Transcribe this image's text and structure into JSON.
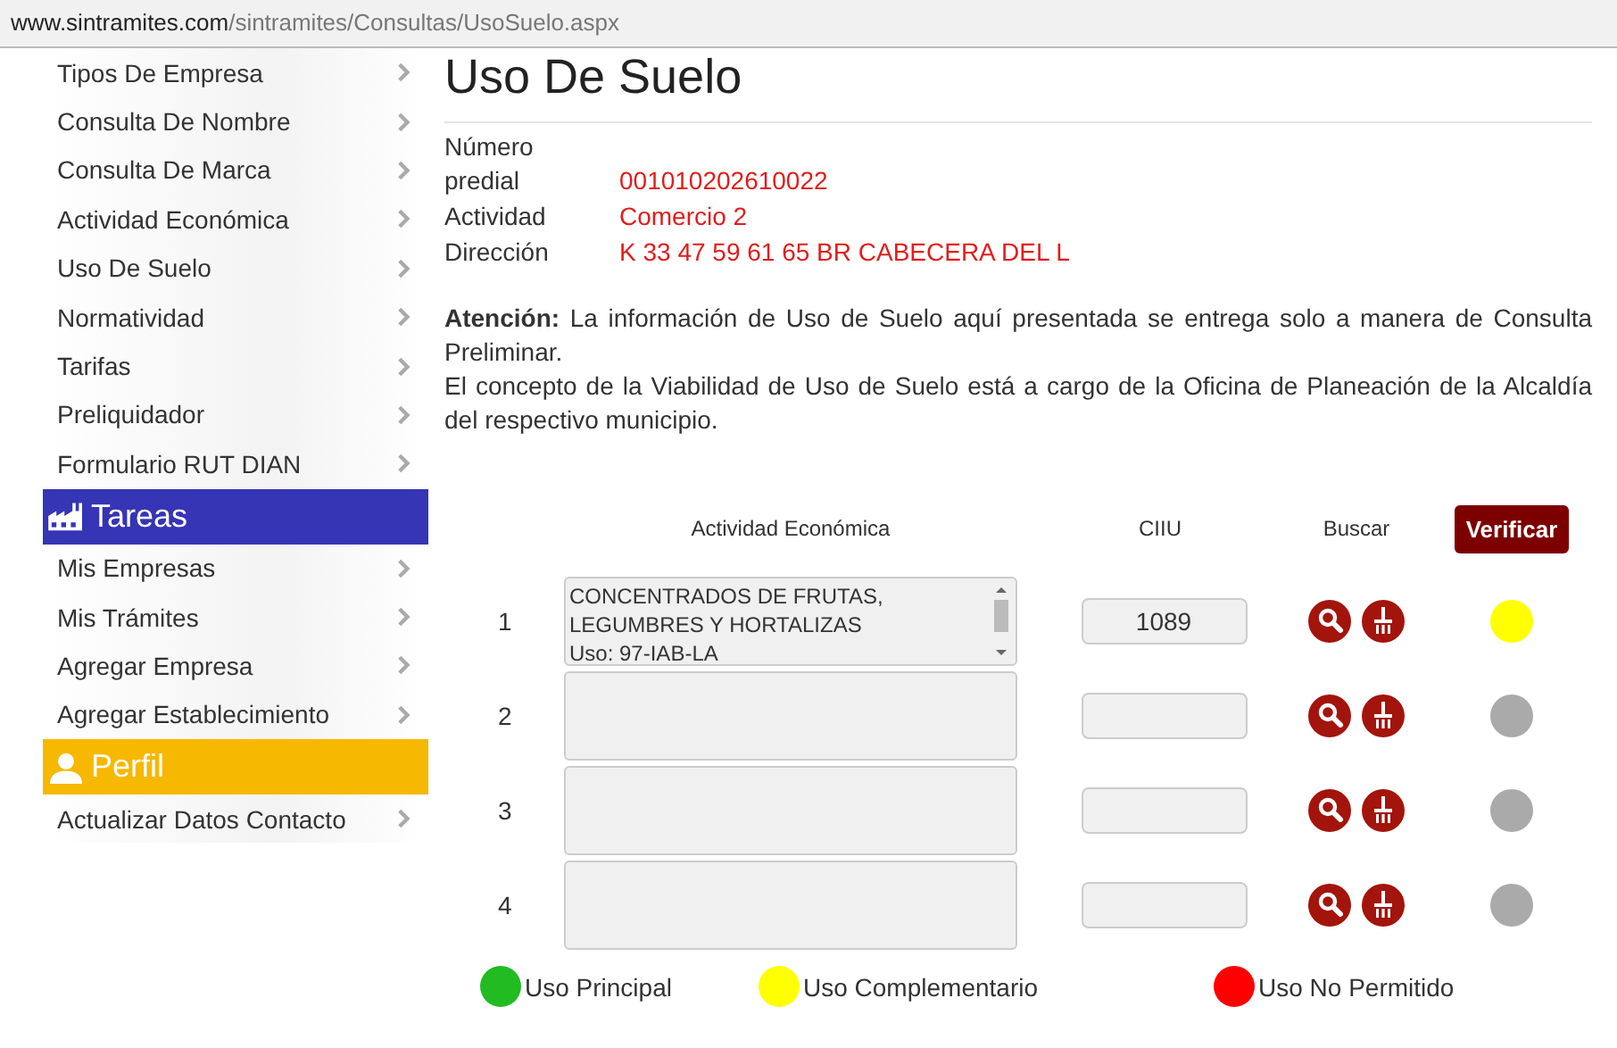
{
  "address_bar": {
    "host": "www.sintramites.com",
    "path": "/sintramites/Consultas/UsoSuelo.aspx"
  },
  "sidebar": {
    "groups": [
      {
        "items": [
          {
            "label": "Tipos De Empresa"
          },
          {
            "label": "Consulta De Nombre"
          },
          {
            "label": "Consulta De Marca"
          },
          {
            "label": "Actividad Económica"
          },
          {
            "label": "Uso De Suelo"
          },
          {
            "label": "Normatividad"
          },
          {
            "label": "Tarifas"
          },
          {
            "label": "Preliquidador"
          },
          {
            "label": "Formulario RUT DIAN"
          }
        ]
      },
      {
        "title": "Tareas",
        "color": "#3535b5",
        "items": [
          {
            "label": "Mis Empresas"
          },
          {
            "label": "Mis Trámites"
          },
          {
            "label": "Agregar Empresa"
          },
          {
            "label": "Agregar Establecimiento"
          }
        ]
      },
      {
        "title": "Perfil",
        "color": "#f6b800",
        "items": [
          {
            "label": "Actualizar Datos Contacto"
          }
        ]
      }
    ]
  },
  "page": {
    "title": "Uso De Suelo",
    "details": [
      {
        "label": "Número predial",
        "value": "001010202610022"
      },
      {
        "label": "Actividad",
        "value": "Comercio 2"
      },
      {
        "label": "Dirección",
        "value": "K 33 47 59 61 65 BR CABECERA DEL L"
      }
    ],
    "notice": [
      "**Atención:** La información de Uso de Suelo aquí presentada se entrega solo a manera de Consulta Preliminar.",
      "El concepto de la Viabilidad de Uso de Suelo está a cargo de la Oficina de Planeación de la Alcaldía del respectivo municipio."
    ]
  },
  "table": {
    "columns": [
      "Actividad Económica",
      "CIIU",
      "Buscar"
    ],
    "verify_button": "Verificar",
    "rows": [
      {
        "number": "1",
        "activity": "CONCENTRADOS DE FRUTAS,\nLEGUMBRES Y HORTALIZAS\nUso: 97-IAB-LA",
        "ciiu": "1089",
        "color": "#ffff00"
      },
      {
        "number": "2",
        "color": "#aaaaaa"
      },
      {
        "number": "3",
        "color": "#aaaaaa"
      },
      {
        "number": "4",
        "color": "#aaaaaa"
      }
    ]
  },
  "legend": [
    {
      "label": "Uso Principal",
      "color": "#22bb22"
    },
    {
      "label": "Uso Complementario",
      "color": "#ffff00"
    },
    {
      "label": "Uso No Permitido",
      "color": "#ff0000"
    }
  ]
}
